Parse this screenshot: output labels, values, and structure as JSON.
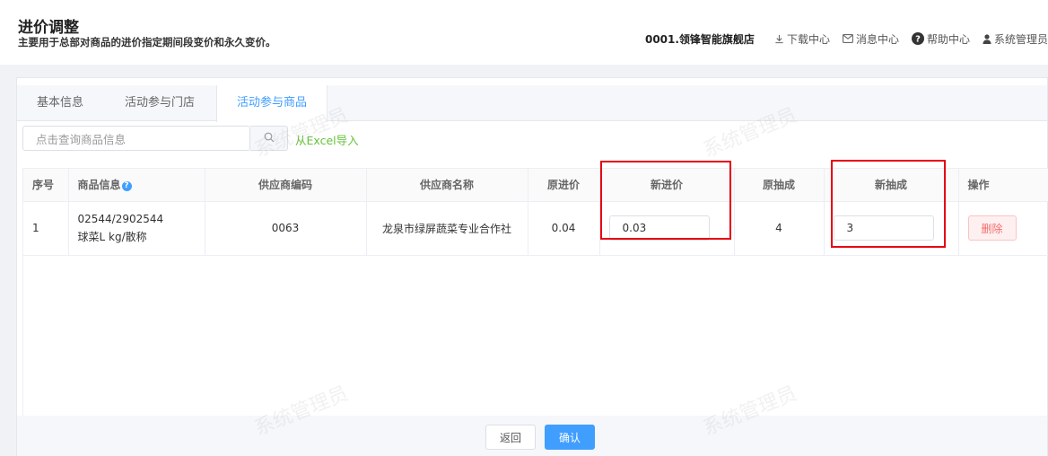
{
  "header": {
    "title": "进价调整",
    "subtitle": "主要用于总部对商品的进价指定期间段变价和永久变价。",
    "store": "0001.领锋智能旗舰店",
    "links": {
      "download": "下载中心",
      "messages": "消息中心",
      "help": "帮助中心",
      "user": "系统管理员"
    }
  },
  "tabs": [
    {
      "label": "基本信息",
      "active": false
    },
    {
      "label": "活动参与门店",
      "active": false
    },
    {
      "label": "活动参与商品",
      "active": true
    }
  ],
  "search": {
    "placeholder": "点击查询商品信息",
    "excel_import": "从Excel导入"
  },
  "table": {
    "columns": [
      "序号",
      "商品信息",
      "供应商编码",
      "供应商名称",
      "原进价",
      "新进价",
      "原抽成",
      "新抽成",
      "操作"
    ],
    "rows": [
      {
        "index": "1",
        "goods_code": "02544/2902544",
        "goods_name": "球菜L kg/散称",
        "supplier_code": "0063",
        "supplier_name": "龙泉市绿屏蔬菜专业合作社",
        "old_price": "0.04",
        "new_price": "0.03",
        "old_commission": "4",
        "new_commission": "3",
        "action": "删除"
      }
    ]
  },
  "footer": {
    "back": "返回",
    "confirm": "确认"
  },
  "watermark": "系统管理员",
  "colors": {
    "accent": "#409eff",
    "excel_link": "#67c23a",
    "danger": "#f56c6c",
    "highlight": "#e60012"
  }
}
